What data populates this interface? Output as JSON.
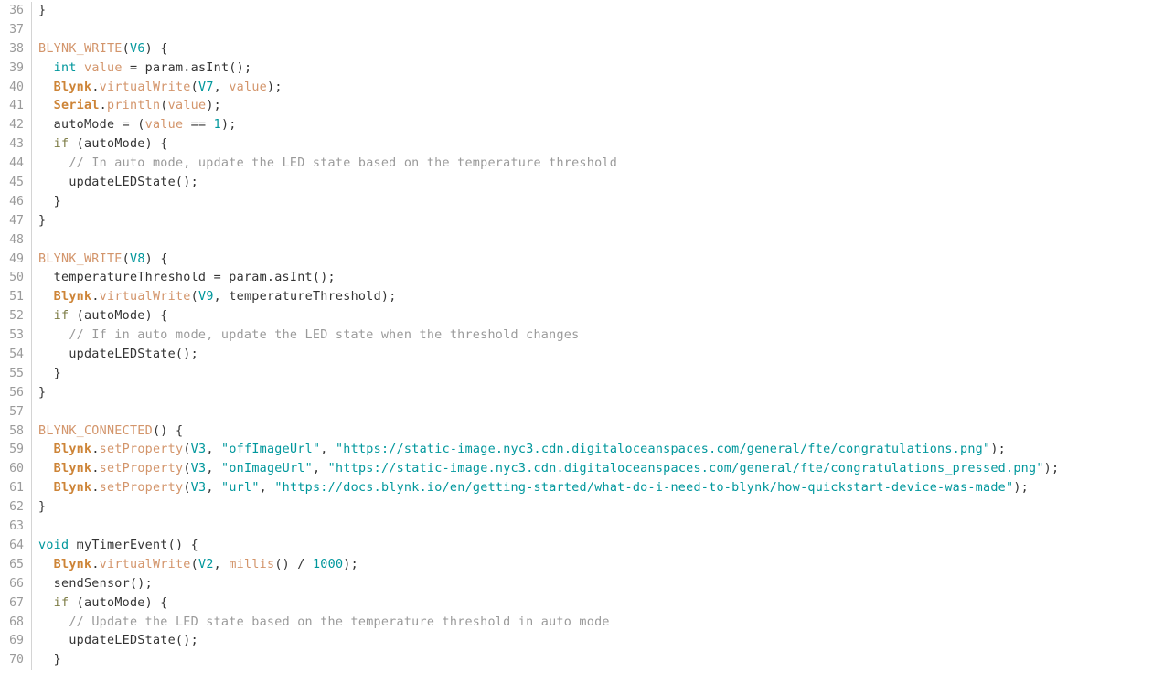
{
  "editor": {
    "language": "cpp",
    "first_line_number": 36,
    "last_line_number": 70,
    "colors": {
      "background": "#ffffff",
      "gutter_text": "#9a9a9a",
      "gutter_separator": "#d4d4d4",
      "plain_text": "#333333",
      "macro": "#d3956b",
      "object": "#cd8437",
      "method": "#d3956b",
      "type_keyword": "#00979c",
      "number": "#00979c",
      "string": "#00979c",
      "comment": "#9a9a9a",
      "control_keyword": "#7e7d47"
    }
  },
  "lines": [
    {
      "n": "36",
      "tokens": [
        {
          "t": "}",
          "c": "plain"
        }
      ]
    },
    {
      "n": "37",
      "tokens": []
    },
    {
      "n": "38",
      "tokens": [
        {
          "t": "BLYNK_WRITE",
          "c": "macro"
        },
        {
          "t": "(",
          "c": "plain"
        },
        {
          "t": "V6",
          "c": "num"
        },
        {
          "t": ") {",
          "c": "plain"
        }
      ]
    },
    {
      "n": "39",
      "tokens": [
        {
          "t": "  ",
          "c": "plain"
        },
        {
          "t": "int",
          "c": "type"
        },
        {
          "t": " ",
          "c": "plain"
        },
        {
          "t": "value",
          "c": "var"
        },
        {
          "t": " = param.asInt();",
          "c": "plain"
        }
      ]
    },
    {
      "n": "40",
      "tokens": [
        {
          "t": "  ",
          "c": "plain"
        },
        {
          "t": "Blynk",
          "c": "object"
        },
        {
          "t": ".",
          "c": "plain"
        },
        {
          "t": "virtualWrite",
          "c": "method"
        },
        {
          "t": "(",
          "c": "plain"
        },
        {
          "t": "V7",
          "c": "num"
        },
        {
          "t": ", ",
          "c": "plain"
        },
        {
          "t": "value",
          "c": "var"
        },
        {
          "t": ");",
          "c": "plain"
        }
      ]
    },
    {
      "n": "41",
      "tokens": [
        {
          "t": "  ",
          "c": "plain"
        },
        {
          "t": "Serial",
          "c": "object"
        },
        {
          "t": ".",
          "c": "plain"
        },
        {
          "t": "println",
          "c": "method"
        },
        {
          "t": "(",
          "c": "plain"
        },
        {
          "t": "value",
          "c": "var"
        },
        {
          "t": ");",
          "c": "plain"
        }
      ]
    },
    {
      "n": "42",
      "tokens": [
        {
          "t": "  autoMode = (",
          "c": "plain"
        },
        {
          "t": "value",
          "c": "var"
        },
        {
          "t": " == ",
          "c": "plain"
        },
        {
          "t": "1",
          "c": "num"
        },
        {
          "t": ");",
          "c": "plain"
        }
      ]
    },
    {
      "n": "43",
      "tokens": [
        {
          "t": "  ",
          "c": "plain"
        },
        {
          "t": "if",
          "c": "kw"
        },
        {
          "t": " (autoMode) {",
          "c": "plain"
        }
      ]
    },
    {
      "n": "44",
      "tokens": [
        {
          "t": "    ",
          "c": "plain"
        },
        {
          "t": "// In auto mode, update the LED state based on the temperature threshold",
          "c": "comment"
        }
      ]
    },
    {
      "n": "45",
      "tokens": [
        {
          "t": "    updateLEDState();",
          "c": "plain"
        }
      ]
    },
    {
      "n": "46",
      "tokens": [
        {
          "t": "  }",
          "c": "plain"
        }
      ]
    },
    {
      "n": "47",
      "tokens": [
        {
          "t": "}",
          "c": "plain"
        }
      ]
    },
    {
      "n": "48",
      "tokens": []
    },
    {
      "n": "49",
      "tokens": [
        {
          "t": "BLYNK_WRITE",
          "c": "macro"
        },
        {
          "t": "(",
          "c": "plain"
        },
        {
          "t": "V8",
          "c": "num"
        },
        {
          "t": ") {",
          "c": "plain"
        }
      ]
    },
    {
      "n": "50",
      "tokens": [
        {
          "t": "  temperatureThreshold = param.asInt();",
          "c": "plain"
        }
      ]
    },
    {
      "n": "51",
      "tokens": [
        {
          "t": "  ",
          "c": "plain"
        },
        {
          "t": "Blynk",
          "c": "object"
        },
        {
          "t": ".",
          "c": "plain"
        },
        {
          "t": "virtualWrite",
          "c": "method"
        },
        {
          "t": "(",
          "c": "plain"
        },
        {
          "t": "V9",
          "c": "num"
        },
        {
          "t": ", temperatureThreshold);",
          "c": "plain"
        }
      ]
    },
    {
      "n": "52",
      "tokens": [
        {
          "t": "  ",
          "c": "plain"
        },
        {
          "t": "if",
          "c": "kw"
        },
        {
          "t": " (autoMode) {",
          "c": "plain"
        }
      ]
    },
    {
      "n": "53",
      "tokens": [
        {
          "t": "    ",
          "c": "plain"
        },
        {
          "t": "// If in auto mode, update the LED state when the threshold changes",
          "c": "comment"
        }
      ]
    },
    {
      "n": "54",
      "tokens": [
        {
          "t": "    updateLEDState();",
          "c": "plain"
        }
      ]
    },
    {
      "n": "55",
      "tokens": [
        {
          "t": "  }",
          "c": "plain"
        }
      ]
    },
    {
      "n": "56",
      "tokens": [
        {
          "t": "}",
          "c": "plain"
        }
      ]
    },
    {
      "n": "57",
      "tokens": []
    },
    {
      "n": "58",
      "tokens": [
        {
          "t": "BLYNK_CONNECTED",
          "c": "macro"
        },
        {
          "t": "() {",
          "c": "plain"
        }
      ]
    },
    {
      "n": "59",
      "tokens": [
        {
          "t": "  ",
          "c": "plain"
        },
        {
          "t": "Blynk",
          "c": "object"
        },
        {
          "t": ".",
          "c": "plain"
        },
        {
          "t": "setProperty",
          "c": "method"
        },
        {
          "t": "(",
          "c": "plain"
        },
        {
          "t": "V3",
          "c": "num"
        },
        {
          "t": ", ",
          "c": "plain"
        },
        {
          "t": "\"offImageUrl\"",
          "c": "str"
        },
        {
          "t": ", ",
          "c": "plain"
        },
        {
          "t": "\"https://static-image.nyc3.cdn.digitaloceanspaces.com/general/fte/congratulations.png\"",
          "c": "str"
        },
        {
          "t": ");",
          "c": "plain"
        }
      ]
    },
    {
      "n": "60",
      "tokens": [
        {
          "t": "  ",
          "c": "plain"
        },
        {
          "t": "Blynk",
          "c": "object"
        },
        {
          "t": ".",
          "c": "plain"
        },
        {
          "t": "setProperty",
          "c": "method"
        },
        {
          "t": "(",
          "c": "plain"
        },
        {
          "t": "V3",
          "c": "num"
        },
        {
          "t": ", ",
          "c": "plain"
        },
        {
          "t": "\"onImageUrl\"",
          "c": "str"
        },
        {
          "t": ", ",
          "c": "plain"
        },
        {
          "t": "\"https://static-image.nyc3.cdn.digitaloceanspaces.com/general/fte/congratulations_pressed.png\"",
          "c": "str"
        },
        {
          "t": ");",
          "c": "plain"
        }
      ]
    },
    {
      "n": "61",
      "tokens": [
        {
          "t": "  ",
          "c": "plain"
        },
        {
          "t": "Blynk",
          "c": "object"
        },
        {
          "t": ".",
          "c": "plain"
        },
        {
          "t": "setProperty",
          "c": "method"
        },
        {
          "t": "(",
          "c": "plain"
        },
        {
          "t": "V3",
          "c": "num"
        },
        {
          "t": ", ",
          "c": "plain"
        },
        {
          "t": "\"url\"",
          "c": "str"
        },
        {
          "t": ", ",
          "c": "plain"
        },
        {
          "t": "\"https://docs.blynk.io/en/getting-started/what-do-i-need-to-blynk/how-quickstart-device-was-made\"",
          "c": "str"
        },
        {
          "t": ");",
          "c": "plain"
        }
      ]
    },
    {
      "n": "62",
      "tokens": [
        {
          "t": "}",
          "c": "plain"
        }
      ]
    },
    {
      "n": "63",
      "tokens": []
    },
    {
      "n": "64",
      "tokens": [
        {
          "t": "void",
          "c": "type"
        },
        {
          "t": " myTimerEvent() {",
          "c": "plain"
        }
      ]
    },
    {
      "n": "65",
      "tokens": [
        {
          "t": "  ",
          "c": "plain"
        },
        {
          "t": "Blynk",
          "c": "object"
        },
        {
          "t": ".",
          "c": "plain"
        },
        {
          "t": "virtualWrite",
          "c": "method"
        },
        {
          "t": "(",
          "c": "plain"
        },
        {
          "t": "V2",
          "c": "num"
        },
        {
          "t": ", ",
          "c": "plain"
        },
        {
          "t": "millis",
          "c": "func"
        },
        {
          "t": "() / ",
          "c": "plain"
        },
        {
          "t": "1000",
          "c": "num"
        },
        {
          "t": ");",
          "c": "plain"
        }
      ]
    },
    {
      "n": "66",
      "tokens": [
        {
          "t": "  sendSensor();",
          "c": "plain"
        }
      ]
    },
    {
      "n": "67",
      "tokens": [
        {
          "t": "  ",
          "c": "plain"
        },
        {
          "t": "if",
          "c": "kw"
        },
        {
          "t": " (autoMode) {",
          "c": "plain"
        }
      ]
    },
    {
      "n": "68",
      "tokens": [
        {
          "t": "    ",
          "c": "plain"
        },
        {
          "t": "// Update the LED state based on the temperature threshold in auto mode",
          "c": "comment"
        }
      ]
    },
    {
      "n": "69",
      "tokens": [
        {
          "t": "    updateLEDState();",
          "c": "plain"
        }
      ]
    },
    {
      "n": "70",
      "tokens": [
        {
          "t": "  }",
          "c": "plain"
        }
      ]
    }
  ]
}
